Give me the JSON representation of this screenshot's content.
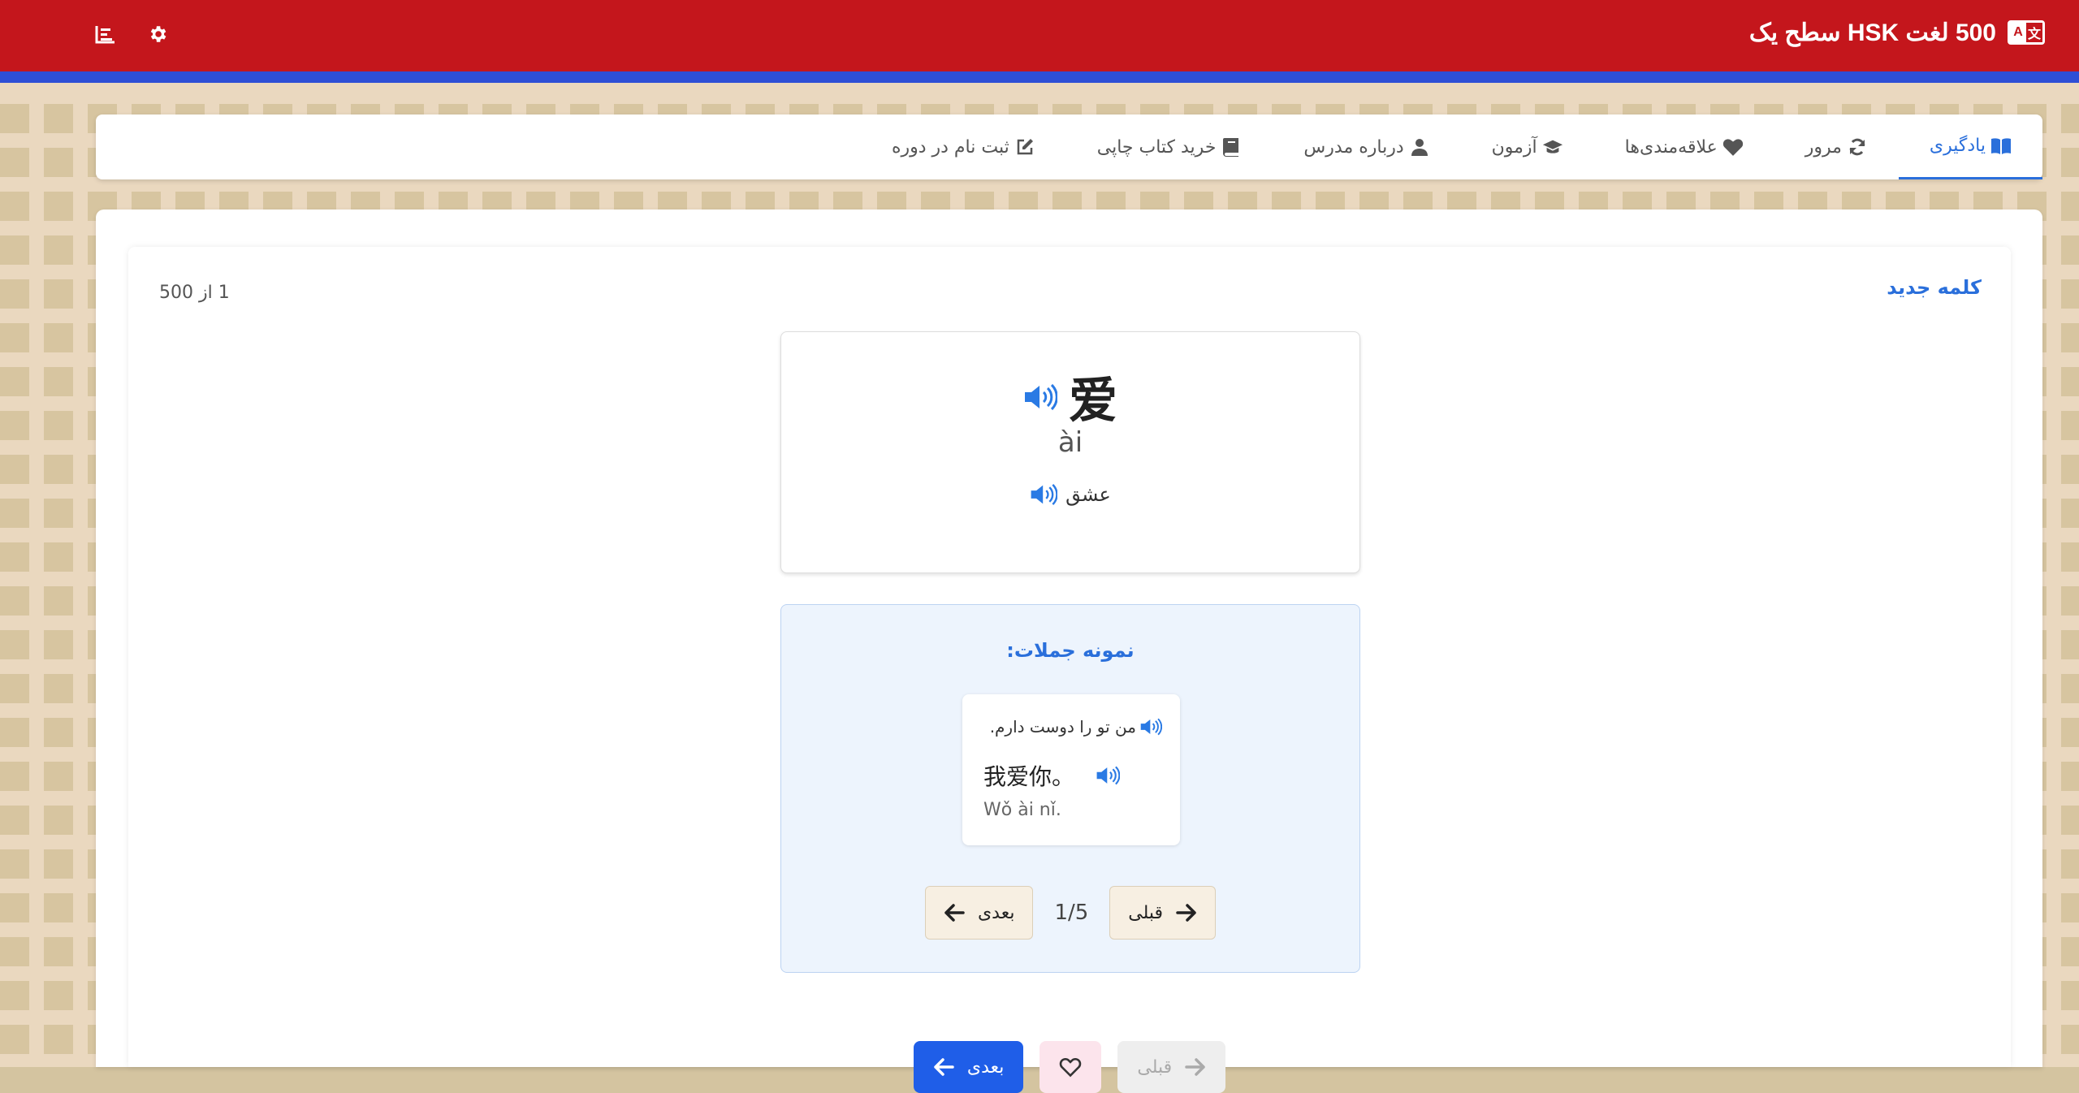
{
  "header": {
    "title": "500 لغت HSK سطح یک",
    "icons": [
      "translate-icon",
      "stats-icon",
      "settings-icon"
    ],
    "color": "#c4161c",
    "stripe_color": "#2e4fd6"
  },
  "nav": {
    "tabs": [
      {
        "label": "یادگیری",
        "icon": "book-open-icon",
        "active": true
      },
      {
        "label": "مرور",
        "icon": "refresh-icon",
        "active": false
      },
      {
        "label": "علاقه‌مندی‌ها",
        "icon": "heart-icon",
        "active": false
      },
      {
        "label": "آزمون",
        "icon": "graduation-cap-icon",
        "active": false
      },
      {
        "label": "درباره مدرس",
        "icon": "user-icon",
        "active": false
      },
      {
        "label": "خرید کتاب چاپی",
        "icon": "book-icon",
        "active": false
      },
      {
        "label": "ثبت نام در دوره",
        "icon": "edit-icon",
        "active": false
      }
    ]
  },
  "main": {
    "section_title": "کلمه جدید",
    "counter": "1 از 500",
    "word": {
      "hanzi": "爱",
      "pinyin": "ài",
      "meaning": "عشق"
    },
    "examples": {
      "title": "نمونه جملات:",
      "current": {
        "persian": "من تو را دوست دارم.",
        "chinese": "我爱你。",
        "pinyin": "Wǒ ài nǐ."
      },
      "pager": {
        "prev_label": "قبلی",
        "next_label": "بعدی",
        "position": "1/5"
      }
    },
    "bottom_nav": {
      "prev_label": "قبلی",
      "next_label": "بعدی"
    }
  },
  "accent_color": "#2a6fdb"
}
